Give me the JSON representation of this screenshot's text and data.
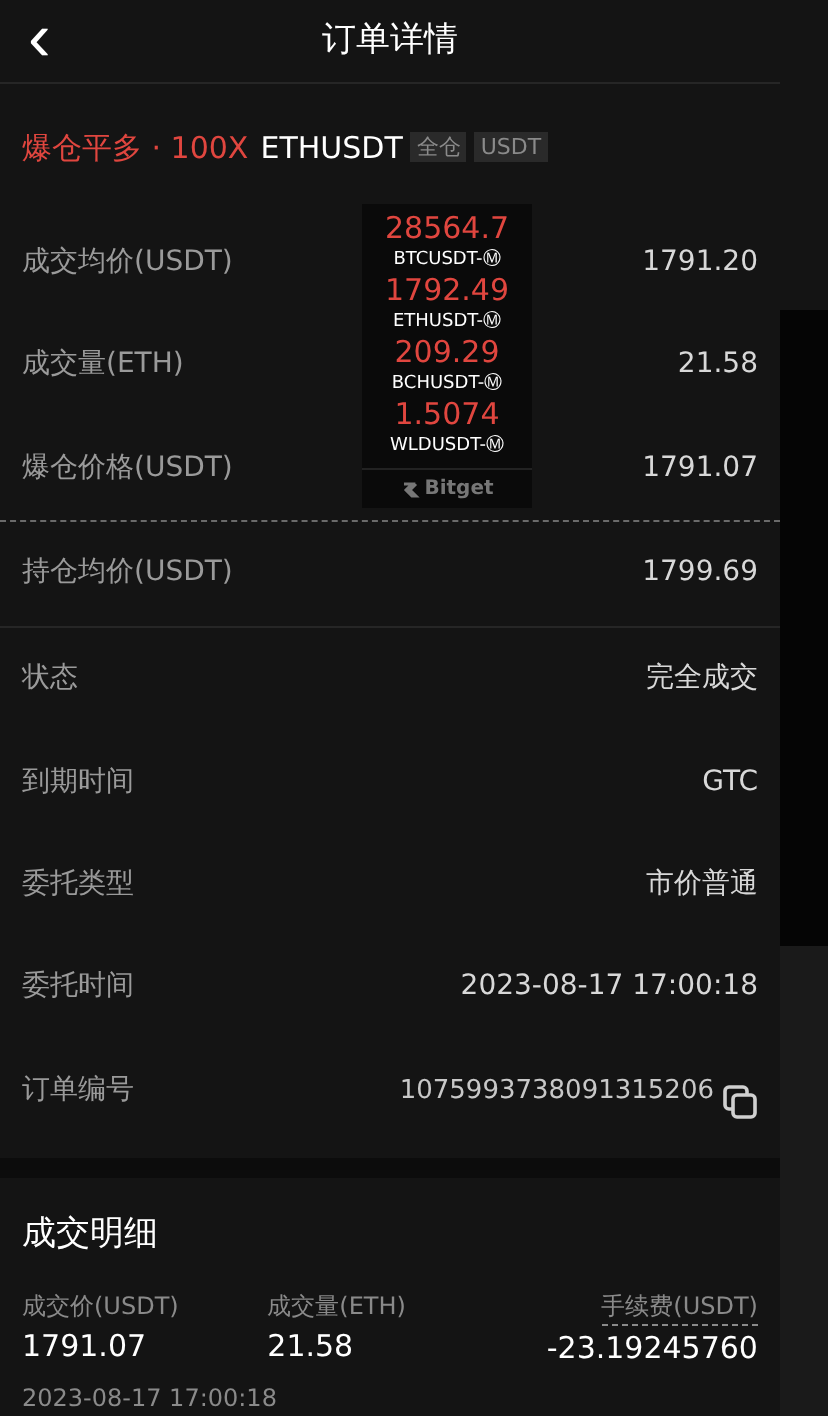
{
  "header": {
    "back_icon": "‹",
    "title": "订单详情"
  },
  "order": {
    "side": "爆仓平多 · 100X",
    "symbol": "ETHUSDT",
    "tags": [
      "全仓",
      "USDT"
    ]
  },
  "price_rows": [
    {
      "label": "成交均价(USDT)",
      "value": "1791.20"
    },
    {
      "label": "成交量(ETH)",
      "value": "21.58"
    },
    {
      "label": "爆仓价格(USDT)",
      "value": "1791.07"
    },
    {
      "label": "持仓均价(USDT)",
      "value": "1799.69"
    }
  ],
  "info_rows": [
    {
      "label": "状态",
      "value": "完全成交"
    },
    {
      "label": "到期时间",
      "value": "GTC"
    },
    {
      "label": "委托类型",
      "value": "市价普通"
    },
    {
      "label": "委托时间",
      "value": "2023-08-17 17:00:18"
    },
    {
      "label": "订单编号",
      "value": "1075993738091315206",
      "copyable": true
    }
  ],
  "fills": {
    "title": "成交明细",
    "columns": [
      {
        "label": "成交价(USDT)",
        "value": "1791.07",
        "dashed": false
      },
      {
        "label": "成交量(ETH)",
        "value": "21.58",
        "dashed": false
      },
      {
        "label": "手续费(USDT)",
        "value": "-23.19245760",
        "dashed": true
      }
    ],
    "time": "2023-08-17 17:00:18"
  },
  "ticker": {
    "items": [
      {
        "price": "28564.7",
        "symbol": "BTCUSDT-Ⓜ"
      },
      {
        "price": "1792.49",
        "symbol": "ETHUSDT-Ⓜ"
      },
      {
        "price": "209.29",
        "symbol": "BCHUSDT-Ⓜ"
      },
      {
        "price": "1.5074",
        "symbol": "WLDUSDT-Ⓜ"
      }
    ],
    "brand": "Bitget"
  }
}
